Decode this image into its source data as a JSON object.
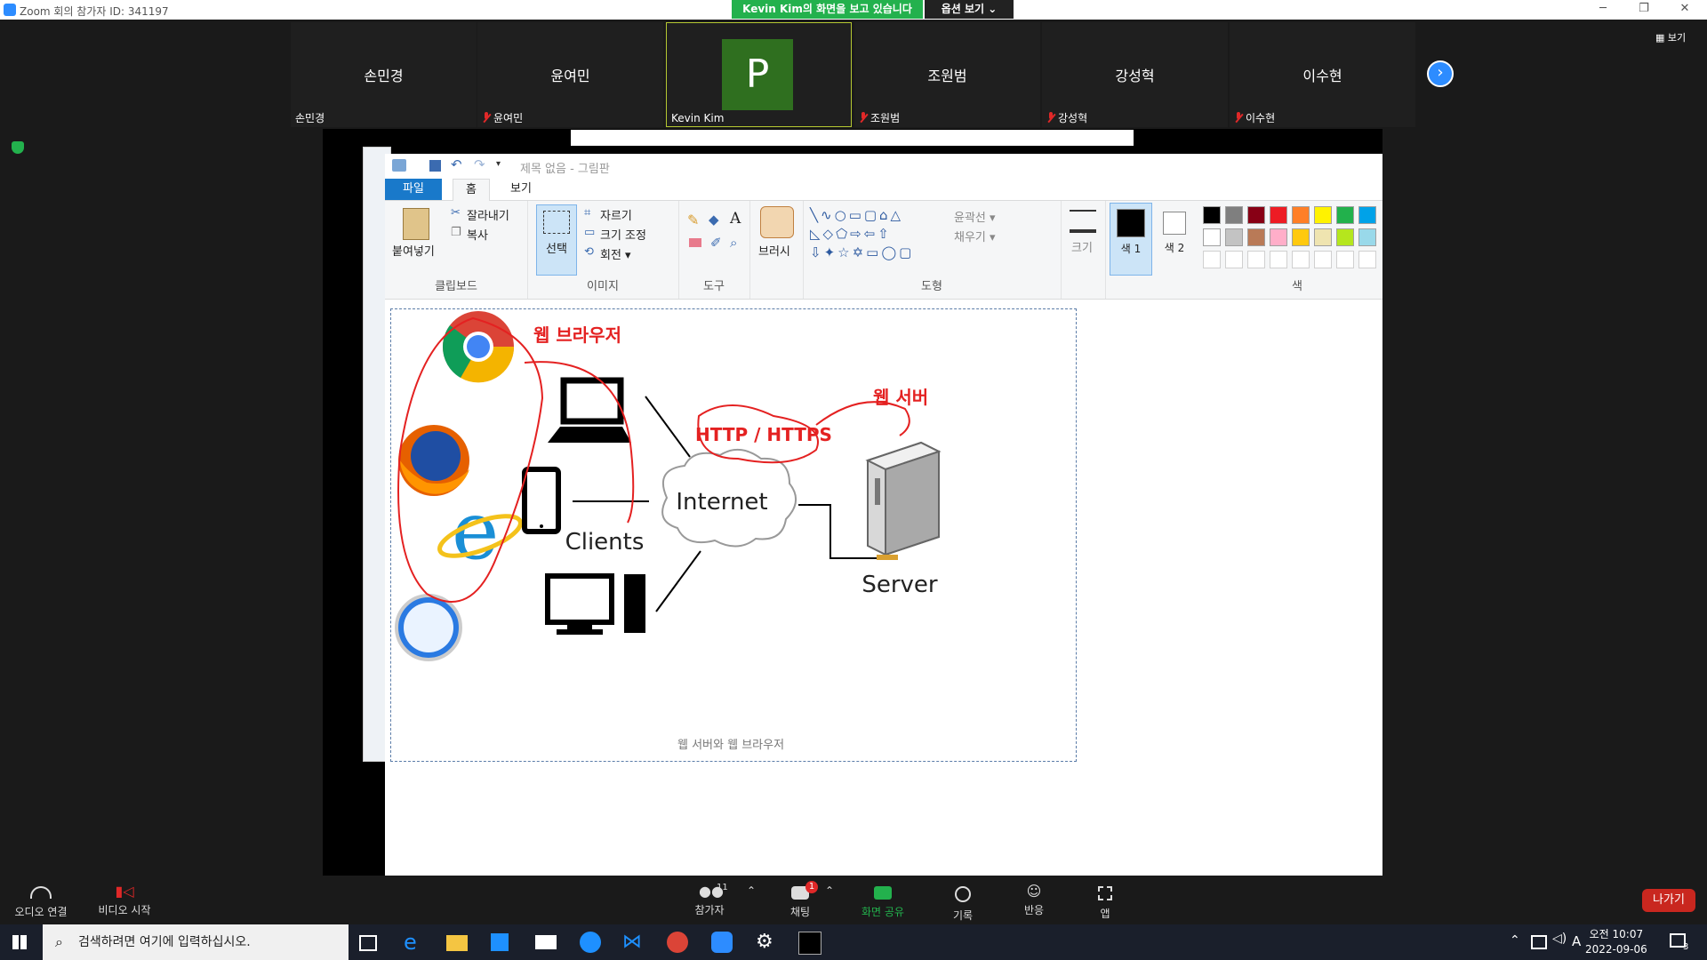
{
  "window": {
    "title": "Zoom 회의 참가자 ID: 341197",
    "share_banner": "Kevin Kim의 화면을 보고 있습니다",
    "options_label": "옵션 보기 ⌄",
    "minimize": "─",
    "restore": "❐",
    "close": "✕"
  },
  "gallery": {
    "view_label": "▦ 보기",
    "tiles": [
      {
        "name": "손민경",
        "label": "손민경",
        "muted": false
      },
      {
        "name": "윤여민",
        "label": "윤여민",
        "muted": true
      },
      {
        "name": "",
        "label": "Kevin Kim",
        "avatar": "P",
        "muted": false,
        "active": true
      },
      {
        "name": "조원범",
        "label": "조원범",
        "muted": true
      },
      {
        "name": "강성혁",
        "label": "강성혁",
        "muted": true
      },
      {
        "name": "이수현",
        "label": "이수현",
        "muted": true
      }
    ],
    "next": "›"
  },
  "paint": {
    "doc_title": "제목 없음 - 그림판",
    "tabs": [
      "파일",
      "홈",
      "보기"
    ],
    "clipboard": {
      "paste": "붙여넣기",
      "cut": "잘라내기",
      "copy": "복사",
      "title": "클립보드"
    },
    "image": {
      "select": "선택",
      "crop": "자르기",
      "resize": "크기 조정",
      "rotate": "회전 ▾",
      "title": "이미지"
    },
    "tools": {
      "title": "도구",
      "text_tool": "A"
    },
    "brush": "브러시",
    "shapes": {
      "title": "도형",
      "outline": "윤곽선 ▾",
      "fill": "채우기 ▾"
    },
    "size": "크기",
    "color1": "색 1",
    "color2": "색 2",
    "colors_title": "색",
    "palette_row1": [
      "#000000",
      "#7f7f7f",
      "#880015",
      "#ed1c24",
      "#ff7f27",
      "#fff200",
      "#22b14c",
      "#00a2e8"
    ],
    "palette_row2": [
      "#ffffff",
      "#c3c3c3",
      "#b97a57",
      "#ffaec9",
      "#ffc90e",
      "#efe4b0",
      "#b5e61d",
      "#99d9ea"
    ],
    "caption": "웹 서버와 웹 브라우저"
  },
  "diagram": {
    "browser_label": "웹 브라우저",
    "server_label": "웹 서버",
    "http_label": "HTTP / HTTPS",
    "internet_label": "Internet",
    "clients_label": "Clients",
    "server_text": "Server",
    "ie_letter": "e"
  },
  "toolbar": {
    "audio": "오디오 연결",
    "video": "비디오 시작",
    "participants": "참가자",
    "participants_count": "11",
    "chat": "채팅",
    "chat_badge": "1",
    "share": "화면 공유",
    "record": "기록",
    "reactions": "반응",
    "apps": "앱",
    "leave": "나가기"
  },
  "taskbar": {
    "search_placeholder": "검색하려면 여기에 입력하십시오.",
    "time": "오전 10:07",
    "date": "2022-09-06",
    "ime": "A",
    "notif_count": "3"
  }
}
